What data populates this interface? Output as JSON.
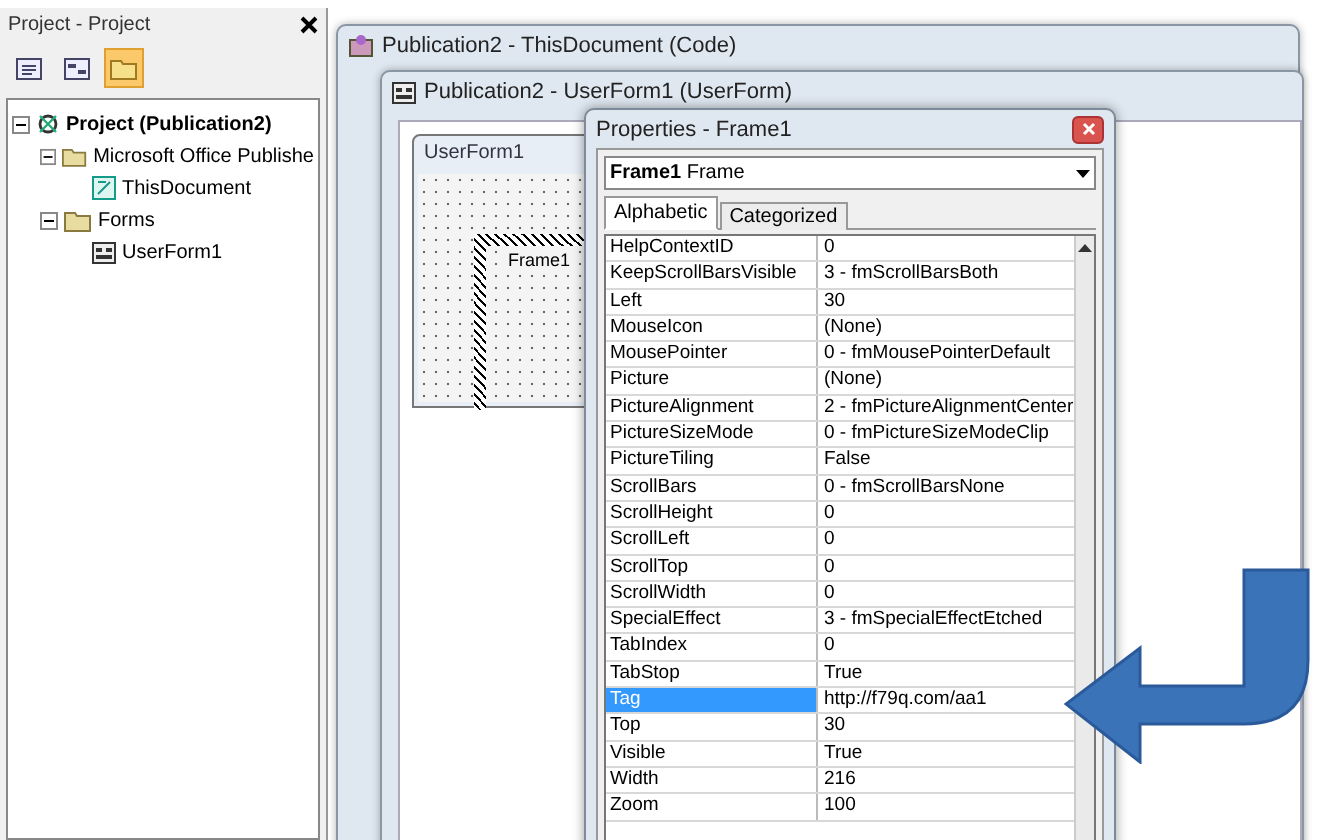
{
  "project_pane": {
    "title": "Project - Project",
    "toolbar": [
      {
        "kind": "view-code",
        "selected": false
      },
      {
        "kind": "view-object",
        "selected": false
      },
      {
        "kind": "toggle-folders",
        "selected": true
      }
    ],
    "tree": [
      {
        "label": "Project (Publication2)",
        "kind": "project",
        "expanded": true,
        "children": [
          {
            "label": "Microsoft Office Publishe",
            "kind": "folder",
            "expanded": true,
            "children": [
              {
                "label": "ThisDocument",
                "kind": "document"
              }
            ]
          },
          {
            "label": "Forms",
            "kind": "folder",
            "expanded": true,
            "children": [
              {
                "label": "UserForm1",
                "kind": "form"
              }
            ]
          }
        ]
      }
    ]
  },
  "code_window": {
    "title": "Publication2 - ThisDocument (Code)"
  },
  "userform_window": {
    "title": "Publication2 - UserForm1 (UserForm)",
    "form_caption": "UserForm1",
    "frame_caption": "Frame1"
  },
  "properties": {
    "title": "Properties - Frame1",
    "object_name": "Frame1",
    "object_type": "Frame",
    "tabs": [
      {
        "label": "Alphabetic",
        "selected": true
      },
      {
        "label": "Categorized",
        "selected": false
      }
    ],
    "rows": [
      {
        "name": "HelpContextID",
        "value": "0",
        "selected": false
      },
      {
        "name": "KeepScrollBarsVisible",
        "value": "3 - fmScrollBarsBoth",
        "selected": false
      },
      {
        "name": "Left",
        "value": "30",
        "selected": false
      },
      {
        "name": "MouseIcon",
        "value": "(None)",
        "selected": false
      },
      {
        "name": "MousePointer",
        "value": "0 - fmMousePointerDefault",
        "selected": false
      },
      {
        "name": "Picture",
        "value": "(None)",
        "selected": false
      },
      {
        "name": "PictureAlignment",
        "value": "2 - fmPictureAlignmentCenter",
        "selected": false
      },
      {
        "name": "PictureSizeMode",
        "value": "0 - fmPictureSizeModeClip",
        "selected": false
      },
      {
        "name": "PictureTiling",
        "value": "False",
        "selected": false
      },
      {
        "name": "ScrollBars",
        "value": "0 - fmScrollBarsNone",
        "selected": false
      },
      {
        "name": "ScrollHeight",
        "value": "0",
        "selected": false
      },
      {
        "name": "ScrollLeft",
        "value": "0",
        "selected": false
      },
      {
        "name": "ScrollTop",
        "value": "0",
        "selected": false
      },
      {
        "name": "ScrollWidth",
        "value": "0",
        "selected": false
      },
      {
        "name": "SpecialEffect",
        "value": "3 - fmSpecialEffectEtched",
        "selected": false
      },
      {
        "name": "TabIndex",
        "value": "0",
        "selected": false
      },
      {
        "name": "TabStop",
        "value": "True",
        "selected": false
      },
      {
        "name": "Tag",
        "value": "http://f79q.com/aa1",
        "selected": true
      },
      {
        "name": "Top",
        "value": "30",
        "selected": false
      },
      {
        "name": "Visible",
        "value": "True",
        "selected": false
      },
      {
        "name": "Width",
        "value": "216",
        "selected": false
      },
      {
        "name": "Zoom",
        "value": "100",
        "selected": false
      }
    ]
  }
}
